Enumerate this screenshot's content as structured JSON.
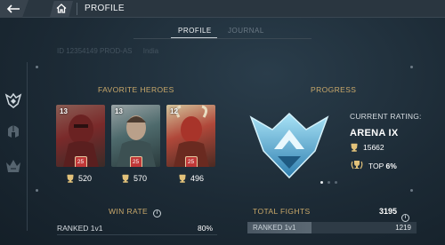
{
  "header": {
    "title": "PROFILE"
  },
  "tabs": [
    {
      "label": "PROFILE",
      "active": true
    },
    {
      "label": "JOURNAL",
      "active": false
    }
  ],
  "id_row": {
    "id_text": "ID 12354149 PROD-AS",
    "region": "India"
  },
  "favorite_heroes": {
    "title": "FAVORITE HEROES",
    "heroes": [
      {
        "level": "13",
        "rank": "25",
        "trophies": "520"
      },
      {
        "level": "13",
        "rank": "25",
        "trophies": "570"
      },
      {
        "level": "12",
        "rank": "25",
        "trophies": "496"
      }
    ]
  },
  "progress": {
    "title": "PROGRESS",
    "current_rating_label": "CURRENT RATING:",
    "arena": "ARENA IX",
    "rating": "15662",
    "top_label": "TOP",
    "top_value": "6%"
  },
  "win_rate": {
    "title": "WIN RATE",
    "info": "i",
    "mode": "RANKED 1v1",
    "value": "80%"
  },
  "total_fights": {
    "title": "TOTAL FIGHTS",
    "total": "3195",
    "info": "i",
    "mode": "RANKED 1v1",
    "value": "1219",
    "fraction": 0.38
  },
  "colors": {
    "accent_gold": "#c9a86a",
    "rank_badge": "#c03838",
    "emblem_blue": "#5fb4dc"
  }
}
